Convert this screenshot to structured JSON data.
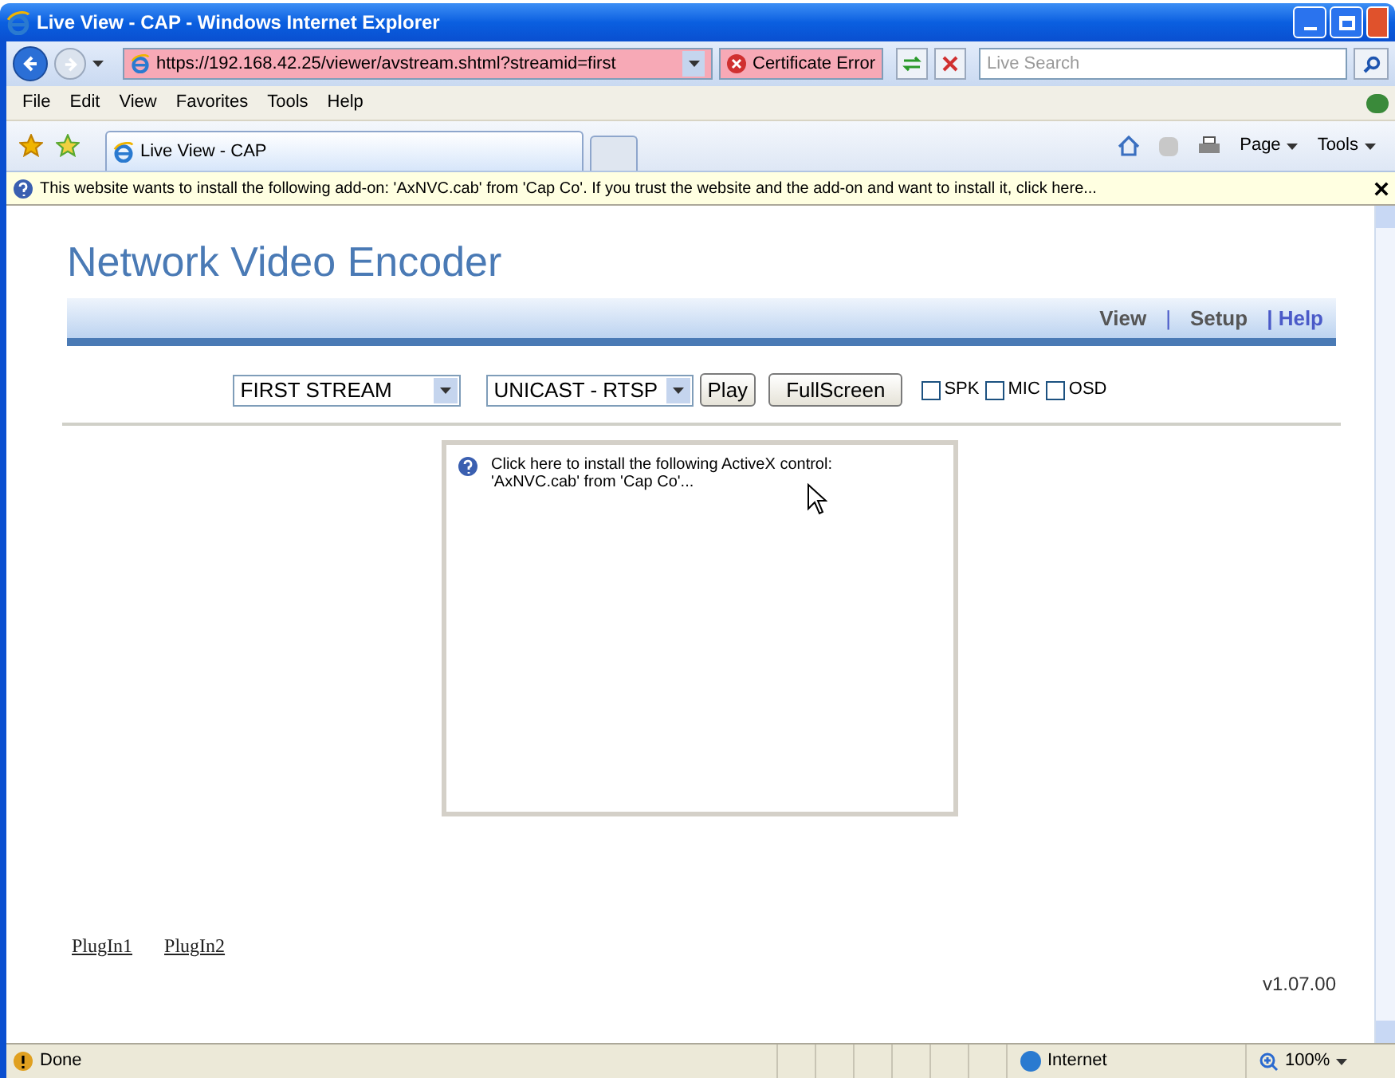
{
  "window": {
    "title": "Live View - CAP - Windows Internet Explorer"
  },
  "address_bar": {
    "url": "https://192.168.42.25/viewer/avstream.shtml?streamid=first",
    "certificate": "Certificate Error"
  },
  "search": {
    "placeholder": "Live Search"
  },
  "menu": [
    "File",
    "Edit",
    "View",
    "Favorites",
    "Tools",
    "Help"
  ],
  "tabs": [
    {
      "label": "Live View - CAP",
      "selected": true
    }
  ],
  "command_bar": [
    "Page",
    "Tools"
  ],
  "info_bar": {
    "text": "This website wants to install the following add-on: 'AxNVC.cab' from 'Cap Co'. If you trust the website and the add-on and want to install it, click here..."
  },
  "page": {
    "heading": "Network Video Encoder",
    "nav": [
      {
        "label": "View",
        "kind": "link"
      },
      {
        "label": "|",
        "kind": "separator"
      },
      {
        "label": "Setup",
        "kind": "link"
      },
      {
        "label": "| Help",
        "kind": "active"
      }
    ],
    "selects": [
      {
        "value": "FIRST STREAM"
      },
      {
        "value": "UNICAST - RTSP"
      }
    ],
    "buttons": [
      "Play",
      "FullScreen"
    ],
    "checkboxes": [
      {
        "label": "SPK",
        "checked": false
      },
      {
        "label": "MIC",
        "checked": false
      },
      {
        "label": "OSD",
        "checked": false
      }
    ],
    "activex": {
      "text": "Click here to install the following ActiveX control: 'AxNVC.cab' from 'Cap Co'..."
    },
    "links": [
      "PlugIn1",
      "PlugIn2"
    ],
    "version": "v1.07.00"
  },
  "status_bar": {
    "status": "Done",
    "zone": "Internet",
    "zoom": "100%"
  }
}
